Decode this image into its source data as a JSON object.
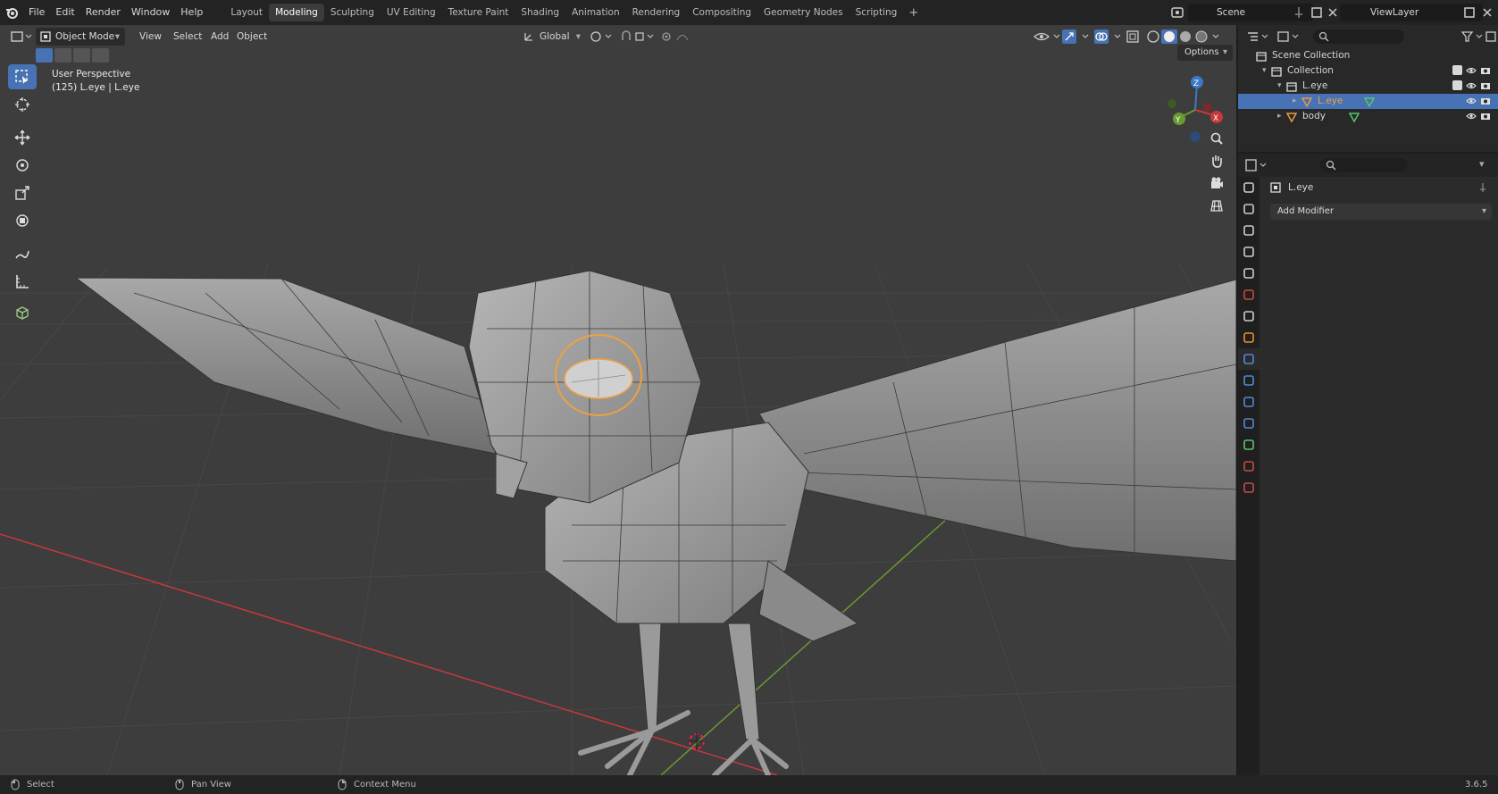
{
  "menu": [
    "File",
    "Edit",
    "Render",
    "Window",
    "Help"
  ],
  "workspaces": [
    {
      "label": "Layout",
      "active": false
    },
    {
      "label": "Modeling",
      "active": true
    },
    {
      "label": "Sculpting",
      "active": false
    },
    {
      "label": "UV Editing",
      "active": false
    },
    {
      "label": "Texture Paint",
      "active": false
    },
    {
      "label": "Shading",
      "active": false
    },
    {
      "label": "Animation",
      "active": false
    },
    {
      "label": "Rendering",
      "active": false
    },
    {
      "label": "Compositing",
      "active": false
    },
    {
      "label": "Geometry Nodes",
      "active": false
    },
    {
      "label": "Scripting",
      "active": false
    }
  ],
  "add_workspace": "+",
  "scene": "Scene",
  "view_layer": "ViewLayer",
  "viewport": {
    "mode": "Object Mode",
    "menus": [
      "View",
      "Select",
      "Add",
      "Object"
    ],
    "orientation": "Global",
    "options": "Options",
    "view_name": "User Perspective",
    "frame_info": "(125) L.eye | L.eye",
    "axes": {
      "x": "X",
      "y": "Y",
      "z": "Z"
    }
  },
  "outliner": {
    "rows": [
      {
        "label": "Scene Collection",
        "indent": 0,
        "icon": "scene-collection-icon",
        "selected": false
      },
      {
        "label": "Collection",
        "indent": 1,
        "icon": "collection-icon",
        "selected": false
      },
      {
        "label": "L.eye",
        "indent": 2,
        "icon": "collection-icon",
        "selected": false
      },
      {
        "label": "L.eye",
        "indent": 3,
        "icon": "mesh-object-icon",
        "selected": true
      },
      {
        "label": "body",
        "indent": 2,
        "icon": "mesh-object-icon",
        "selected": false
      }
    ]
  },
  "properties": {
    "object_name": "L.eye",
    "add_modifier": "Add Modifier",
    "active_tab": "modifier-tab"
  },
  "statusbar": {
    "select": "Select",
    "pan": "Pan View",
    "context": "Context Menu",
    "version": "3.6.5"
  },
  "colors": {
    "accent": "#4772b3",
    "selection_outline": "#f0a040",
    "x_axis": "#c8383a",
    "y_axis": "#6a9a30",
    "z_axis": "#3a78c8"
  }
}
